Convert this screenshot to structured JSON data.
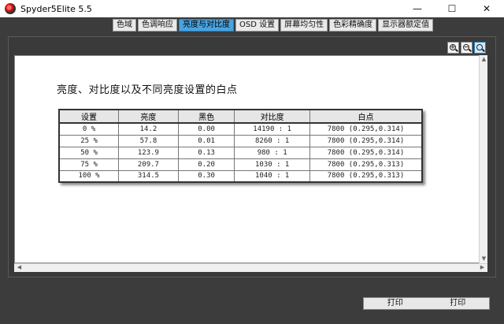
{
  "window": {
    "title": "Spyder5Elite 5.5",
    "minimize": "—",
    "maximize": "☐",
    "close": "✕"
  },
  "tabs": [
    {
      "label": "色域",
      "active": false
    },
    {
      "label": "色调响应",
      "active": false
    },
    {
      "label": "亮度与对比度",
      "active": true
    },
    {
      "label": "OSD 设置",
      "active": false
    },
    {
      "label": "屏幕均匀性",
      "active": false
    },
    {
      "label": "色彩精确度",
      "active": false
    },
    {
      "label": "显示器额定值",
      "active": false
    }
  ],
  "zoom": {
    "zoom_in": "+",
    "zoom_out": "−"
  },
  "document": {
    "title": "亮度、对比度以及不同亮度设置的白点",
    "table": {
      "headers": [
        "设置",
        "亮度",
        "黑色",
        "对比度",
        "白点"
      ],
      "rows": [
        [
          "0 %",
          "14.2",
          "0.00",
          "14190 : 1",
          "7800 (0.295,0.314)"
        ],
        [
          "25 %",
          "57.8",
          "0.01",
          "8260 : 1",
          "7800 (0.295,0.314)"
        ],
        [
          "50 %",
          "123.9",
          "0.13",
          "980 : 1",
          "7800 (0.295,0.314)"
        ],
        [
          "75 %",
          "209.7",
          "0.20",
          "1030 : 1",
          "7800 (0.295,0.313)"
        ],
        [
          "100 %",
          "314.5",
          "0.30",
          "1040 : 1",
          "7800 (0.295,0.313)"
        ]
      ]
    }
  },
  "footer": {
    "print1": "打印",
    "print2": "打印"
  },
  "colors": {
    "active_tab": "#4aa3df",
    "background": "#3c3c3c"
  }
}
